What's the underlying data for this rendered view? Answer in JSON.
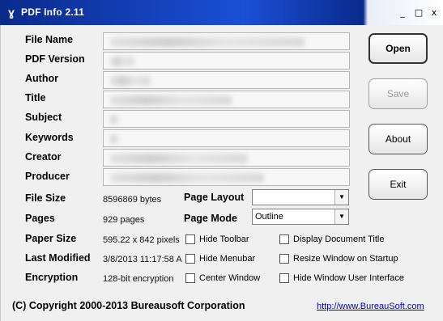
{
  "window": {
    "title": "PDF Info 2.11",
    "controls": {
      "minimize": "_",
      "maximize": "□",
      "close": "x"
    }
  },
  "labels": {
    "file_name": "File Name",
    "pdf_version": "PDF Version",
    "author": "Author",
    "title": "Title",
    "subject": "Subject",
    "keywords": "Keywords",
    "creator": "Creator",
    "producer": "Producer",
    "file_size": "File Size",
    "pages": "Pages",
    "paper_size": "Paper Size",
    "last_modified": "Last Modified",
    "encryption": "Encryption",
    "page_layout": "Page Layout",
    "page_mode": "Page Mode"
  },
  "values": {
    "file_size": "8596869 bytes",
    "pages": "929 pages",
    "paper_size": "595.22 x 842 pixels",
    "last_modified": "3/8/2013 11:17:58 A",
    "encryption": "128-bit encryption"
  },
  "selects": {
    "page_layout": "",
    "page_mode": "Outline"
  },
  "buttons": {
    "open": "Open",
    "save": "Save",
    "about": "About",
    "exit": "Exit"
  },
  "checkboxes": {
    "hide_toolbar": "Hide Toolbar",
    "hide_menubar": "Hide Menubar",
    "center_window": "Center Window",
    "display_document_title": "Display Document Title",
    "resize_window_on_startup": "Resize Window on Startup",
    "hide_window_user_interface": "Hide Window User Interface"
  },
  "footer": {
    "copyright": "(C) Copyright 2000-2013 Bureausoft Corporation",
    "link": "http://www.BureauSoft.com"
  },
  "icons": {
    "app": "app-icon",
    "dropdown": "chevron-down-icon"
  },
  "colors": {
    "titlebar": "#1b4fd6",
    "background": "#f0f0f0",
    "link": "#0000cc"
  }
}
